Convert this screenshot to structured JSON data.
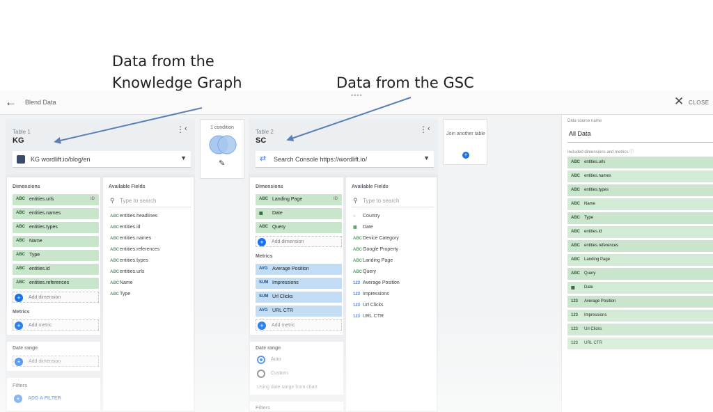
{
  "annotations": {
    "kg_line1": "Data from the",
    "kg_line2": "Knowledge Graph",
    "gsc": "Data from the GSC"
  },
  "header": {
    "title": "Blend Data",
    "close_label": "CLOSE",
    "back_icon": "arrow-back-icon",
    "close_icon": "close-icon"
  },
  "table1": {
    "caption": "Table 1",
    "name": "KG",
    "source": "KG wordlift.io/blog/en",
    "dimensions_header": "Dimensions",
    "dimensions": [
      "entities.urls",
      "entities.names",
      "entities.types",
      "Name",
      "Type",
      "entities.id",
      "entities.references"
    ],
    "add_dimension": "Add dimension",
    "metrics_header": "Metrics",
    "add_metric": "Add metric",
    "date_range_header": "Date range",
    "add_date": "Add dimension",
    "filters_header": "Filters",
    "add_filter": "ADD A FILTER",
    "available_header": "Available Fields",
    "search_placeholder": "Type to search",
    "available": [
      "entities.headlines",
      "entities.id",
      "entities.names",
      "entities.references",
      "entities.types",
      "entities.urls",
      "Name",
      "Type"
    ]
  },
  "join_condition": {
    "label": "1 condition"
  },
  "table2": {
    "caption": "Table 2",
    "name": "SC",
    "source": "Search Console https://wordlift.io/",
    "dimensions_header": "Dimensions",
    "dimensions": [
      "Landing Page",
      "Date",
      "Query"
    ],
    "add_dimension": "Add dimension",
    "metrics_header": "Metrics",
    "metrics": [
      "Average Position",
      "Impressions",
      "Url Clicks",
      "URL CTR"
    ],
    "add_metric": "Add metric",
    "date_range_header": "Date range",
    "date_auto": "Auto",
    "date_custom": "Custom",
    "date_note": "Using date range from chart",
    "filters_header": "Filters",
    "available_header": "Available Fields",
    "search_placeholder": "Type to search",
    "available": [
      "Country",
      "Date",
      "Device Category",
      "Google Property",
      "Landing Page",
      "Query",
      "Average Position",
      "Impressions",
      "Url Clicks",
      "URL CTR"
    ]
  },
  "join_another": {
    "label": "Join another table"
  },
  "blended": {
    "source_name_label": "Data source name",
    "source_name": "All Data",
    "included_label": "Included dimensions and metrics",
    "fields": [
      "entities.urls",
      "entities.names",
      "entities.types",
      "Name",
      "Type",
      "entities.id",
      "entities.references",
      "Landing Page",
      "Query",
      "Date",
      "Average Position",
      "Impressions",
      "Url Clicks",
      "URL CTR"
    ]
  }
}
